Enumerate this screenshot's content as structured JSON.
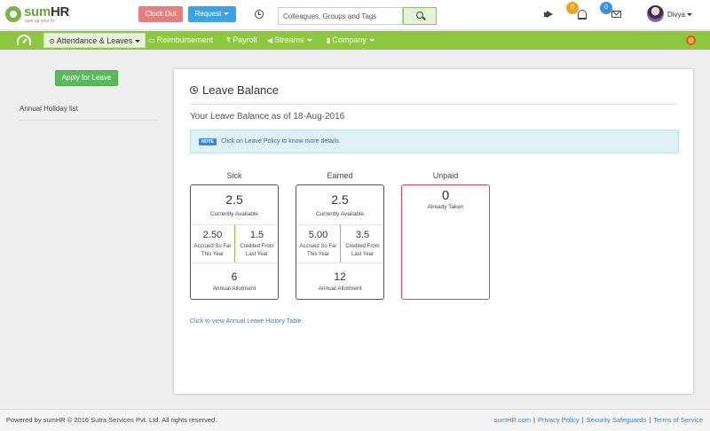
{
  "header": {
    "logo_text_a": "sum",
    "logo_text_b": "HR",
    "logo_tagline": "sum up your hr",
    "clock_out_label": "Clock Out",
    "request_label": "Request",
    "search_placeholder": "Colleagues, Groups and Tags",
    "announcements_count": "0",
    "notifications_count": "0",
    "user_name": "Divya"
  },
  "nav": {
    "items": [
      {
        "label": "Attendance & Leaves",
        "icon": "clock-icon",
        "active": true
      },
      {
        "label": "Reimbursement",
        "icon": "money-icon"
      },
      {
        "label": "Payroll",
        "icon": "rupee-icon"
      },
      {
        "label": "Streams",
        "icon": "megaphone-icon"
      },
      {
        "label": "Company",
        "icon": "building-icon"
      }
    ]
  },
  "sidebar": {
    "apply_label": "Apply for Leave",
    "links": [
      "Annual Holiday list"
    ]
  },
  "main": {
    "title": "Leave Balance",
    "as_of": "Your Leave Balance as of 18-Aug-2016",
    "note_tag": "NOTE",
    "note_text": "Click on Leave Policy to know more details.",
    "leave_types": [
      {
        "name": "Sick",
        "available": "2.5",
        "available_label": "Currently Available",
        "accrued": "2.50",
        "accrued_label_1": "Accrued So Far",
        "accrued_label_2": "This Year",
        "credited": "1.5",
        "credited_label_1": "Credited From",
        "credited_label_2": "Last Year",
        "allotment": "6",
        "allotment_label": "Annual Allotment"
      },
      {
        "name": "Earned",
        "available": "2.5",
        "available_label": "Currently Available",
        "accrued": "5.00",
        "accrued_label_1": "Accrued So Far",
        "accrued_label_2": "This Year",
        "credited": "3.5",
        "credited_label_1": "Credited From",
        "credited_label_2": "Last Year",
        "allotment": "12",
        "allotment_label": "Annual Allotment"
      },
      {
        "name": "Unpaid",
        "taken": "0",
        "taken_label": "Already Taken"
      }
    ],
    "history_link": "Click to view Annual Leave History Table"
  },
  "footer": {
    "copyright": "Powered by sumHR © 2016 Sutra Services Pvt. Ltd. All rights reserved.",
    "links": [
      "sumHR.com",
      "Privacy Policy",
      "Security Safeguards",
      "Terms of Service"
    ],
    "separator": "|"
  },
  "colors": {
    "brand_green": "#8dc63f",
    "clock_out": "#e57f7f",
    "request": "#3da2e0",
    "unpaid_border": "#dc3f52"
  }
}
